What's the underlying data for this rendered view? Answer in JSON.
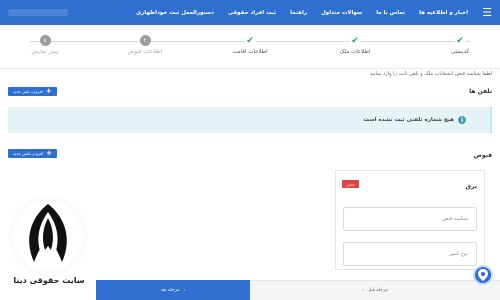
{
  "topbar": {
    "nav": [
      "اخبار و اطلاعیه ها",
      "تماس با ما",
      "سوالات متداول",
      "راهنما",
      "ثبت افراد حقوقی",
      "دستورالعمل ثبت خوداظهاری"
    ]
  },
  "steps": [
    {
      "label": "کدپستی",
      "state": "done",
      "num": ""
    },
    {
      "label": "اطلاعات ملک",
      "state": "done",
      "num": ""
    },
    {
      "label": "اطلاعات اقامت",
      "state": "done",
      "num": ""
    },
    {
      "label": "اطلاعات قبوض",
      "state": "pending",
      "num": "۴"
    },
    {
      "label": "پیش نمایش",
      "state": "pending",
      "num": "۵"
    }
  ],
  "intro_text": "لطفا شناسه قبض انشعابات ملک و تلفن ثابت را وارد نمایید",
  "phones": {
    "title": "تلفن ها",
    "add_label": "افزودن تلفن جدید",
    "empty_message": "هیچ شماره تلفنی ثبت نشده است"
  },
  "bills": {
    "title": "قبوض",
    "add_label": "افزودن قبض جدید",
    "card": {
      "title": "برق",
      "remove_label": "حذف",
      "fields": [
        {
          "placeholder": "شناسه قبض"
        },
        {
          "placeholder": "نوع کنتور"
        }
      ]
    }
  },
  "footer": {
    "next_label": "مرحله بعد",
    "prev_label": "مرحله قبل"
  },
  "watermark": {
    "text": "سایت حقوقی دینا"
  },
  "colors": {
    "primary": "#2e6fd0",
    "success": "#2eaa3f",
    "danger": "#e04545",
    "info_bg": "#e4f4f6"
  }
}
